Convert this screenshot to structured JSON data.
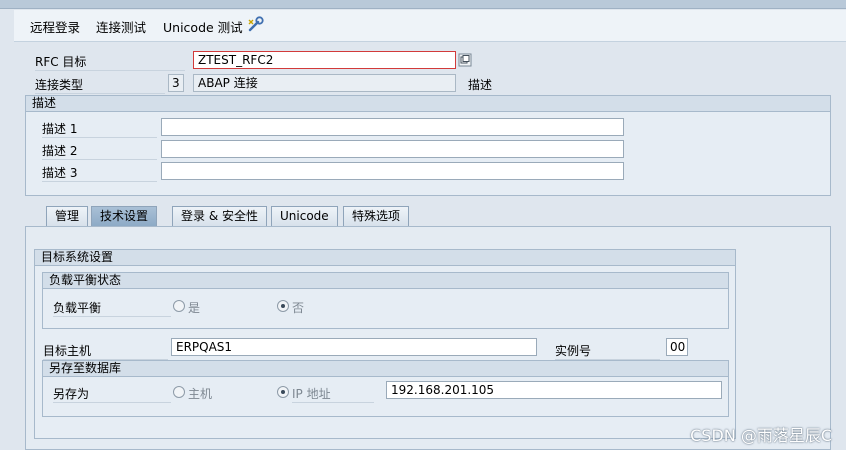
{
  "toolbar": {
    "remote_login": "远程登录",
    "connection_test": "连接测试",
    "unicode_test": "Unicode 测试"
  },
  "header": {
    "rfc_target_label": "RFC 目标",
    "rfc_target_value": "ZTEST_RFC2",
    "connection_type_label": "连接类型",
    "connection_type_code": "3",
    "connection_type_value": "ABAP 连接",
    "description_label": "描述"
  },
  "description_group": {
    "title": "描述",
    "rows": [
      {
        "label": "描述 1",
        "value": ""
      },
      {
        "label": "描述 2",
        "value": ""
      },
      {
        "label": "描述 3",
        "value": ""
      }
    ]
  },
  "tabs": [
    {
      "label": "管理",
      "active": false
    },
    {
      "label": "技术设置",
      "active": true
    },
    {
      "label": "登录 & 安全性",
      "active": false
    },
    {
      "label": "Unicode",
      "active": false
    },
    {
      "label": "特殊选项",
      "active": false
    }
  ],
  "target_system": {
    "title": "目标系统设置",
    "load_balance": {
      "title": "负载平衡状态",
      "label": "负载平衡",
      "option_yes": "是",
      "option_no": "否",
      "selected": "否"
    },
    "target_host_label": "目标主机",
    "target_host_value": "ERPQAS1",
    "instance_label": "实例号",
    "instance_value": "00",
    "save_to_db": {
      "title": "另存至数据库",
      "label": "另存为",
      "option_host": "主机",
      "option_ip": "IP 地址",
      "selected": "IP 地址",
      "ip_value": "192.168.201.105"
    }
  },
  "watermark": "CSDN @雨落星辰C"
}
